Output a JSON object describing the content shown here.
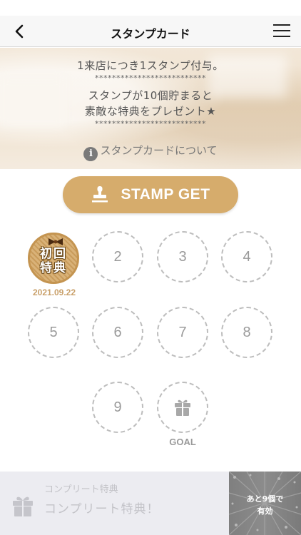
{
  "nav": {
    "title": "スタンプカード"
  },
  "banner": {
    "line1": "1来店につき1スタンプ付与。",
    "stars1": "**************************",
    "line2": "スタンプが10個貯まると",
    "line3": "素敵な特典をプレゼント★",
    "stars2": "**************************",
    "about_link": "スタンプカードについて"
  },
  "stamp_button": {
    "label": "STAMP GET"
  },
  "stamps": {
    "first": {
      "label_line1": "初回",
      "label_line2": "特典",
      "date": "2021.09.22",
      "collected": true
    },
    "slots": [
      {
        "number": "2",
        "collected": false
      },
      {
        "number": "3",
        "collected": false
      },
      {
        "number": "4",
        "collected": false
      },
      {
        "number": "5",
        "collected": false
      },
      {
        "number": "6",
        "collected": false
      },
      {
        "number": "7",
        "collected": false
      },
      {
        "number": "8",
        "collected": false
      },
      {
        "number": "9",
        "collected": false
      }
    ],
    "goal_label": "GOAL"
  },
  "complete": {
    "caption": "コンプリート特典",
    "title": "コンプリート特典！",
    "remaining_line1": "あと9個で",
    "remaining_line2": "有効"
  },
  "colors": {
    "accent_gold": "#d6ac6c",
    "date_gold": "#c9a06a",
    "slot_border": "#bdbdbd",
    "panel_bg": "#ececf1"
  }
}
